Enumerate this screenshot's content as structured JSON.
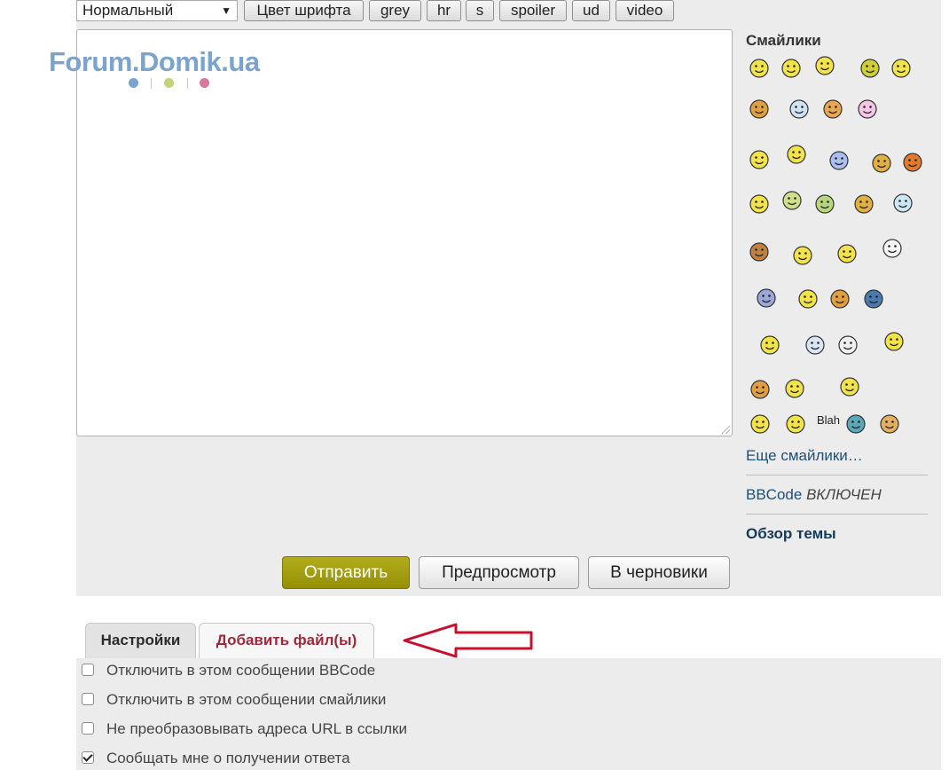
{
  "toolbar": {
    "font_size_value": "Нормальный",
    "font_color_label": "Цвет шрифта",
    "buttons": [
      "grey",
      "hr",
      "s",
      "spoiler",
      "ud",
      "video"
    ]
  },
  "watermark": {
    "logo_text": "Forum.Domik.ua"
  },
  "sidebar": {
    "smilies_title": "Смайлики",
    "more_smilies": "Еще смайлики…",
    "bbcode_label": "BBCode",
    "bbcode_state": "ВКЛЮЧЕН",
    "topic_review": "Обзор темы"
  },
  "actions": {
    "submit": "Отправить",
    "preview": "Предпросмотр",
    "save_draft": "В черновики"
  },
  "tabs": {
    "settings": "Настройки",
    "attachments": "Добавить файл(ы)"
  },
  "options": [
    {
      "label": "Отключить в этом сообщении BBCode",
      "checked": false
    },
    {
      "label": "Отключить в этом сообщении смайлики",
      "checked": false
    },
    {
      "label": "Не преобразовывать адреса URL в ссылки",
      "checked": false
    },
    {
      "label": "Сообщать мне о получении ответа",
      "checked": true
    }
  ],
  "smiley_blah_text": "Blah",
  "colors": {
    "submit_bg": "#a39f0d",
    "attach_tab_text": "#a0283a",
    "arrow_red": "#c8102e",
    "link_blue": "#1d4f7a",
    "logo_blue": "#7aa3cf"
  }
}
